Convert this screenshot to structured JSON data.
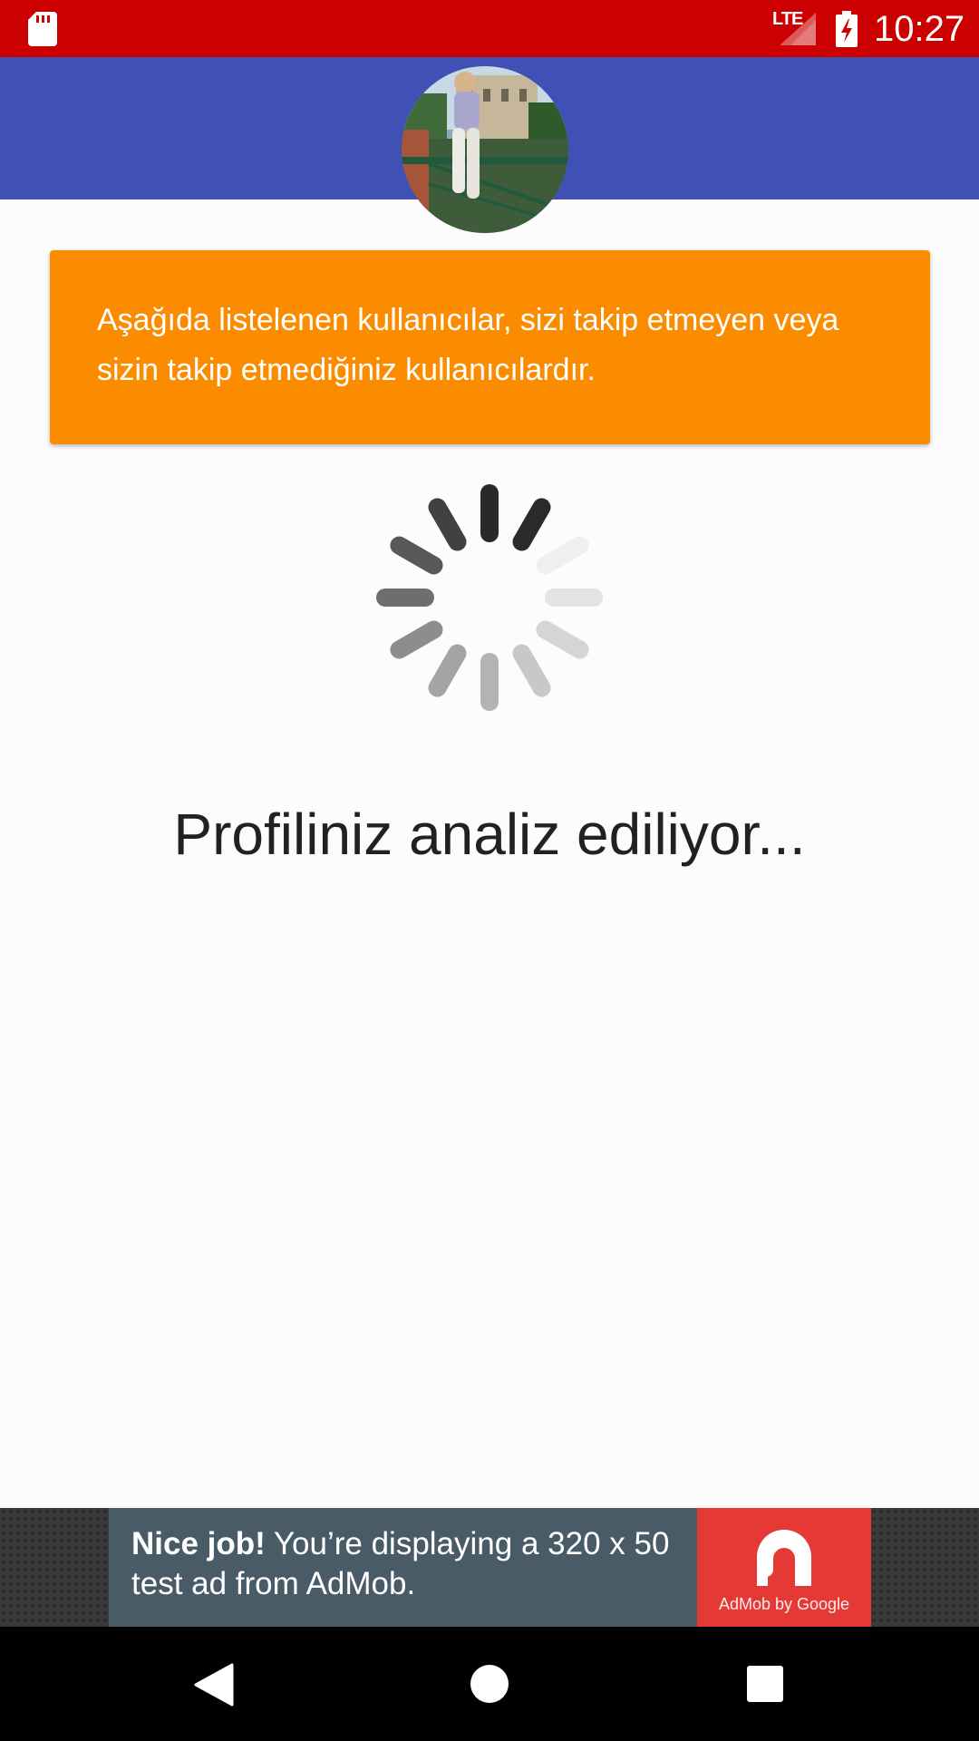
{
  "status_bar": {
    "time": "10:27",
    "network": "LTE",
    "color": "#cc0000",
    "icons": [
      "sd-card-icon",
      "signal-icon",
      "battery-charging-icon"
    ]
  },
  "header": {
    "color": "#3f51b5",
    "avatar": "profile-photo"
  },
  "info_card": {
    "text": "Aşağıda listelenen kullanıcılar, sizi takip etmeyen veya sizin takip etmediğiniz kullanıcılardır.",
    "color": "#fb8c00"
  },
  "loading": {
    "icon": "spinner-icon",
    "text": "Profiliniz analiz ediliyor..."
  },
  "ad": {
    "headline": "Nice job!",
    "body": " You’re displaying a 320 x 50 test ad from AdMob.",
    "logo_caption": "AdMob by Google",
    "color": "#4a5b68",
    "logo_color": "#e53935"
  },
  "nav_bar": {
    "icons": [
      "back-icon",
      "home-icon",
      "recents-icon"
    ]
  }
}
